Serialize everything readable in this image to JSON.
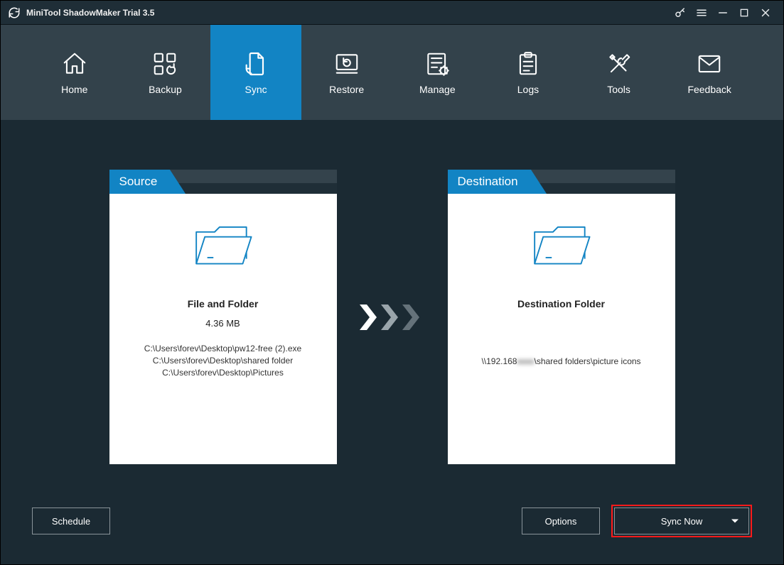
{
  "app": {
    "title": "MiniTool ShadowMaker Trial 3.5"
  },
  "nav": {
    "home": {
      "label": "Home"
    },
    "backup": {
      "label": "Backup"
    },
    "sync": {
      "label": "Sync"
    },
    "restore": {
      "label": "Restore"
    },
    "manage": {
      "label": "Manage"
    },
    "logs": {
      "label": "Logs"
    },
    "tools": {
      "label": "Tools"
    },
    "feedback": {
      "label": "Feedback"
    }
  },
  "source": {
    "header": "Source",
    "title": "File and Folder",
    "size": "4.36 MB",
    "line1": "C:\\Users\\forev\\Desktop\\pw12-free (2).exe",
    "line2": "C:\\Users\\forev\\Desktop\\shared folder",
    "line3": "C:\\Users\\forev\\Desktop\\Pictures"
  },
  "destination": {
    "header": "Destination",
    "title": "Destination Folder",
    "path_prefix": "\\\\192.168",
    "path_blurred": "xxxx",
    "path_suffix": "\\shared folders\\picture icons"
  },
  "footer": {
    "schedule": "Schedule",
    "options": "Options",
    "sync_now": "Sync Now"
  }
}
